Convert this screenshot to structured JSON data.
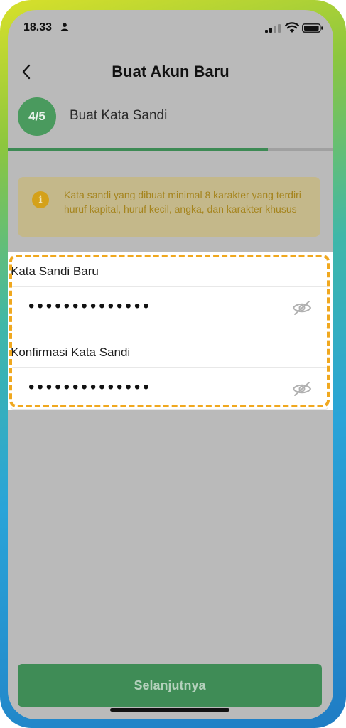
{
  "status_bar": {
    "time": "18.33"
  },
  "header": {
    "title": "Buat Akun Baru"
  },
  "step": {
    "badge": "4/5",
    "label": "Buat Kata Sandi",
    "progress": 0.8
  },
  "alert": {
    "icon": "info-icon",
    "text": "Kata sandi yang dibuat minimal 8 karakter yang terdiri huruf kapital, huruf kecil, angka, dan karakter khusus"
  },
  "form": {
    "new_password": {
      "label": "Kata Sandi Baru",
      "value": "••••••••••••••"
    },
    "confirm_password": {
      "label": "Konfirmasi Kata Sandi",
      "value": "••••••••••••••"
    }
  },
  "footer": {
    "next_label": "Selanjutnya"
  },
  "colors": {
    "accent_green": "#3f8c56",
    "highlight_dash": "#f0a81f",
    "info_yellow": "#d4a11a"
  }
}
